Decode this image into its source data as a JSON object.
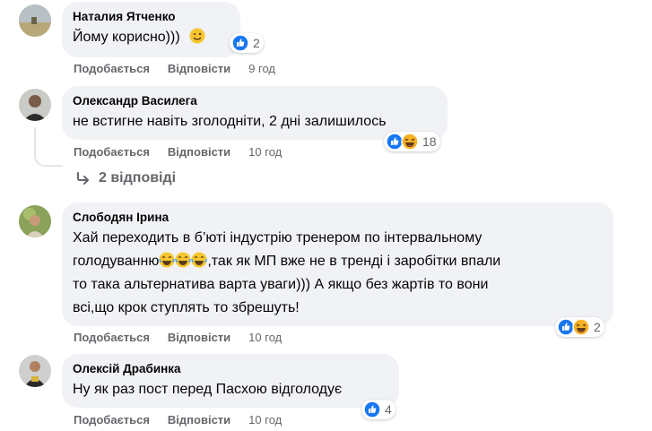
{
  "comments": [
    {
      "author": "Наталия Ятченко",
      "text_lines": [
        "Йому корисно)))"
      ],
      "like_label": "Подобається",
      "reply_label": "Відповісти",
      "time": "9 год",
      "reaction_count": "2"
    },
    {
      "author": "Олександр Василега",
      "text_lines": [
        "не встигне навіть зголодніти, 2 дні залишилось"
      ],
      "like_label": "Подобається",
      "reply_label": "Відповісти",
      "time": "10 год",
      "reaction_count": "18",
      "replies_label": "2 відповіді"
    },
    {
      "author": "Слободян Ірина",
      "text_lines": [
        "Хай переходить в б’юті індустрію тренером по інтервальному",
        "голодуванню",
        ",так як МП вже не в тренді і заробітки впали",
        "то така альтернатива варта уваги))) А якщо без жартів то вони",
        "всі,що крок ступлять то збрешуть!"
      ],
      "like_label": "Подобається",
      "reply_label": "Відповісти",
      "time": "10 год",
      "reaction_count": "2"
    },
    {
      "author": "Олексій Драбинка",
      "text_lines": [
        "Ну як раз пост перед Пасхою відголодує"
      ],
      "like_label": "Подобається",
      "reply_label": "Відповісти",
      "time": "10 год",
      "reaction_count": "4"
    }
  ],
  "colors": {
    "bubble": "#f0f2f5",
    "meta": "#65676b",
    "like_blue": "#1877f2",
    "haha_yellow": "#f7b125"
  }
}
